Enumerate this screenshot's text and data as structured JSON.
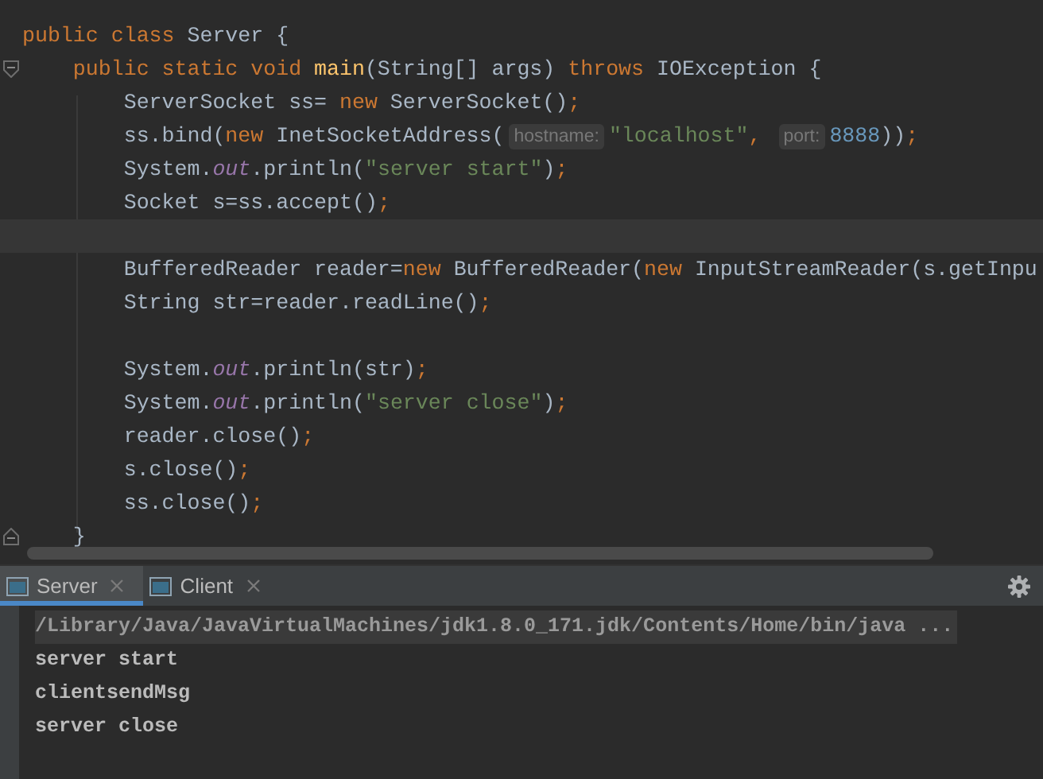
{
  "editor": {
    "lines": [
      {
        "kind": "code",
        "tokens": [
          {
            "kind": "keyword",
            "text": "public class"
          },
          {
            "kind": "plain",
            "text": " Server {"
          }
        ]
      },
      {
        "kind": "code",
        "fold": true,
        "tokens": [
          {
            "kind": "keyword",
            "text": "    public static void "
          },
          {
            "kind": "method",
            "text": "main"
          },
          {
            "kind": "plain",
            "text": "(String[] args) "
          },
          {
            "kind": "keyword",
            "text": "throws"
          },
          {
            "kind": "plain",
            "text": " IOException {"
          }
        ]
      },
      {
        "kind": "code",
        "tokens": [
          {
            "kind": "plain",
            "text": "        ServerSocket ss= "
          },
          {
            "kind": "keyword",
            "text": "new"
          },
          {
            "kind": "plain",
            "text": " ServerSocket()"
          },
          {
            "kind": "keyword",
            "text": ";"
          }
        ]
      },
      {
        "kind": "code",
        "tokens": [
          {
            "kind": "plain",
            "text": "        ss.bind("
          },
          {
            "kind": "keyword",
            "text": "new"
          },
          {
            "kind": "plain",
            "text": " InetSocketAddress("
          },
          {
            "kind": "hint",
            "text": "hostname:"
          },
          {
            "kind": "string",
            "text": "\"localhost\""
          },
          {
            "kind": "keyword",
            "text": ", "
          },
          {
            "kind": "hint",
            "text": "port:"
          },
          {
            "kind": "number",
            "text": "8888"
          },
          {
            "kind": "plain",
            "text": "))"
          },
          {
            "kind": "keyword",
            "text": ";"
          }
        ]
      },
      {
        "kind": "code",
        "tokens": [
          {
            "kind": "plain",
            "text": "        System."
          },
          {
            "kind": "field",
            "text": "out"
          },
          {
            "kind": "plain",
            "text": ".println("
          },
          {
            "kind": "string",
            "text": "\"server start\""
          },
          {
            "kind": "plain",
            "text": ")"
          },
          {
            "kind": "keyword",
            "text": ";"
          }
        ]
      },
      {
        "kind": "code",
        "tokens": [
          {
            "kind": "plain",
            "text": "        Socket s=ss.accept()"
          },
          {
            "kind": "keyword",
            "text": ";"
          }
        ]
      },
      {
        "kind": "caret_line"
      },
      {
        "kind": "code",
        "tokens": [
          {
            "kind": "plain",
            "text": "        BufferedReader reader="
          },
          {
            "kind": "keyword",
            "text": "new"
          },
          {
            "kind": "plain",
            "text": " BufferedReader("
          },
          {
            "kind": "keyword",
            "text": "new"
          },
          {
            "kind": "plain",
            "text": " InputStreamReader(s.getInpu"
          }
        ]
      },
      {
        "kind": "code",
        "tokens": [
          {
            "kind": "plain",
            "text": "        String str=reader.readLine()"
          },
          {
            "kind": "keyword",
            "text": ";"
          }
        ]
      },
      {
        "kind": "blank"
      },
      {
        "kind": "code",
        "tokens": [
          {
            "kind": "plain",
            "text": "        System."
          },
          {
            "kind": "field",
            "text": "out"
          },
          {
            "kind": "plain",
            "text": ".println(str)"
          },
          {
            "kind": "keyword",
            "text": ";"
          }
        ]
      },
      {
        "kind": "code",
        "tokens": [
          {
            "kind": "plain",
            "text": "        System."
          },
          {
            "kind": "field",
            "text": "out"
          },
          {
            "kind": "plain",
            "text": ".println("
          },
          {
            "kind": "string",
            "text": "\"server close\""
          },
          {
            "kind": "plain",
            "text": ")"
          },
          {
            "kind": "keyword",
            "text": ";"
          }
        ]
      },
      {
        "kind": "code",
        "tokens": [
          {
            "kind": "plain",
            "text": "        reader.close()"
          },
          {
            "kind": "keyword",
            "text": ";"
          }
        ]
      },
      {
        "kind": "code",
        "tokens": [
          {
            "kind": "plain",
            "text": "        s.close()"
          },
          {
            "kind": "keyword",
            "text": ";"
          }
        ]
      },
      {
        "kind": "code",
        "tokens": [
          {
            "kind": "plain",
            "text": "        ss.close()"
          },
          {
            "kind": "keyword",
            "text": ";"
          }
        ]
      },
      {
        "kind": "code",
        "fold": true,
        "tokens": [
          {
            "kind": "plain",
            "text": "    }"
          }
        ]
      }
    ]
  },
  "run_tabs": [
    {
      "label": "Server",
      "selected": true
    },
    {
      "label": "Client",
      "selected": false
    }
  ],
  "console": {
    "lines": [
      {
        "kind": "command",
        "text": "/Library/Java/JavaVirtualMachines/jdk1.8.0_171.jdk/Contents/Home/bin/java ..."
      },
      {
        "kind": "output",
        "text": "server start"
      },
      {
        "kind": "output",
        "text": "clientsendMsg"
      },
      {
        "kind": "output",
        "text": "server close"
      }
    ]
  }
}
